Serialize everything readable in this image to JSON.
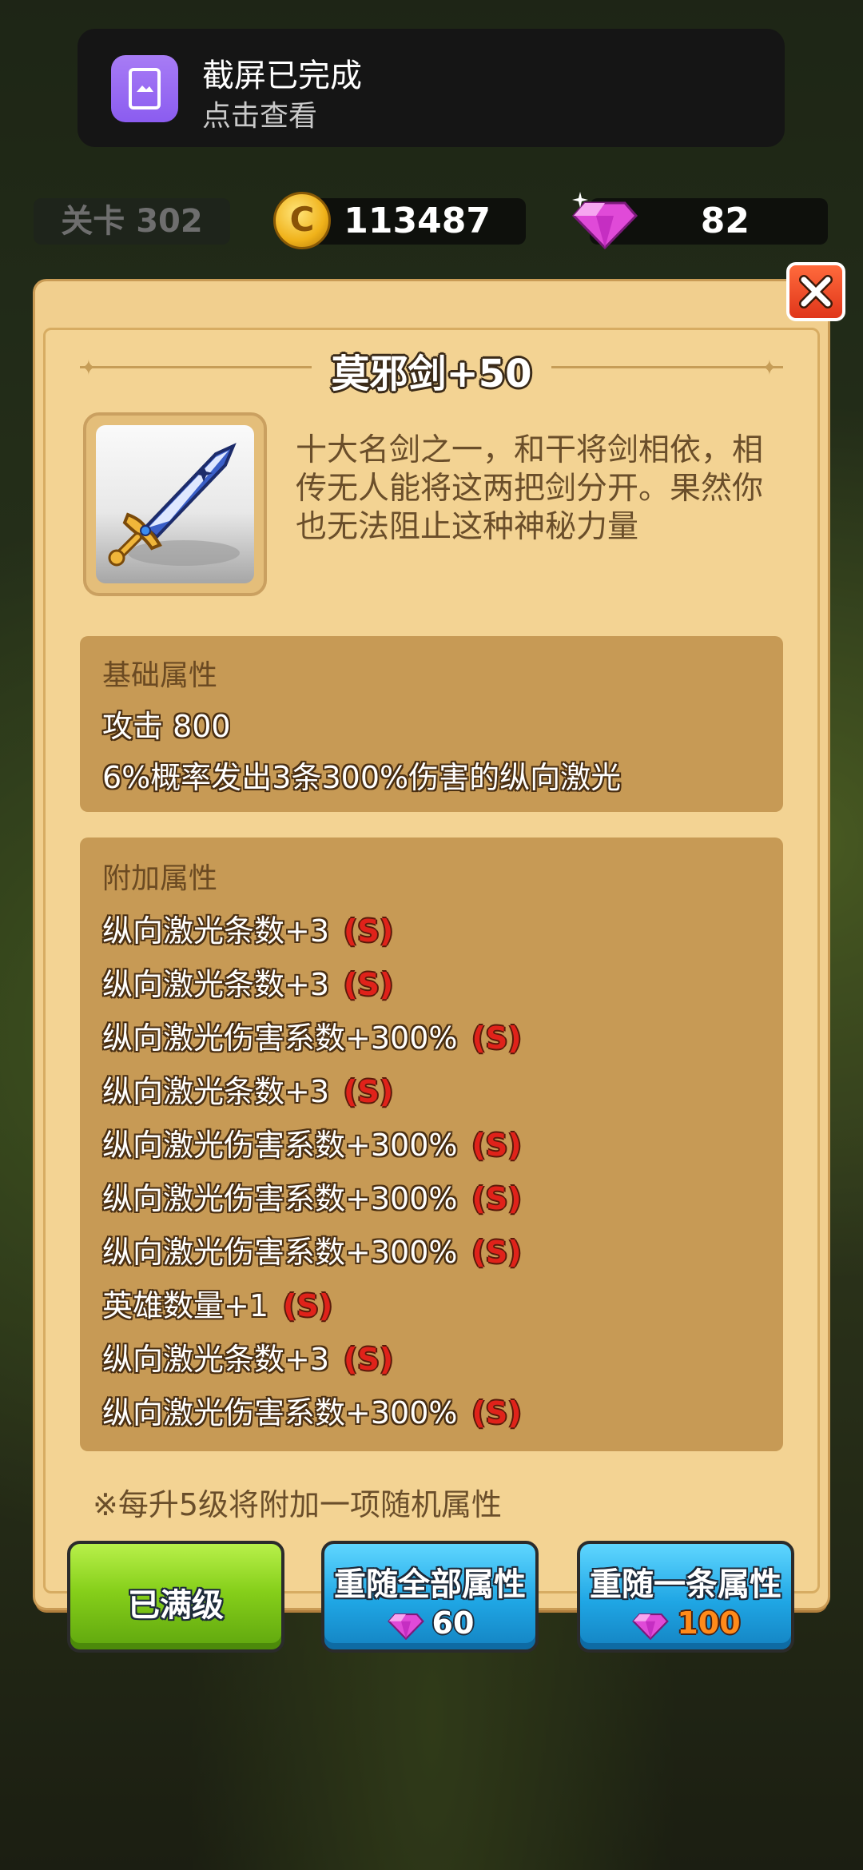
{
  "notification": {
    "title": "截屏已完成",
    "subtitle": "点击查看"
  },
  "topbar": {
    "stage": "关卡 302",
    "coins": "113487",
    "gems": "82",
    "coin_symbol": "C"
  },
  "item": {
    "name": "莫邪剑+50",
    "description": "十大名剑之一，和干将剑相依，相传无人能将这两把剑分开。果然你也无法阻止这种神秘力量"
  },
  "base_attributes": {
    "label": "基础属性",
    "lines": [
      "攻击 800",
      "6%概率发出3条300%伤害的纵向激光"
    ]
  },
  "extra_attributes": {
    "label": "附加属性",
    "lines": [
      {
        "text": "纵向激光条数+3",
        "grade": "(S)"
      },
      {
        "text": "纵向激光条数+3",
        "grade": "(S)"
      },
      {
        "text": "纵向激光伤害系数+300%",
        "grade": "(S)"
      },
      {
        "text": "纵向激光条数+3",
        "grade": "(S)"
      },
      {
        "text": "纵向激光伤害系数+300%",
        "grade": "(S)"
      },
      {
        "text": "纵向激光伤害系数+300%",
        "grade": "(S)"
      },
      {
        "text": "纵向激光伤害系数+300%",
        "grade": "(S)"
      },
      {
        "text": "英雄数量+1",
        "grade": "(S)"
      },
      {
        "text": "纵向激光条数+3",
        "grade": "(S)"
      },
      {
        "text": "纵向激光伤害系数+300%",
        "grade": "(S)"
      }
    ]
  },
  "note": "※每升5级将附加一项随机属性",
  "buttons": {
    "max_level": "已满级",
    "reroll_all": {
      "label": "重随全部属性",
      "cost": "60"
    },
    "reroll_one": {
      "label": "重随一条属性",
      "cost": "100"
    }
  },
  "colors": {
    "panel": "#f3d393",
    "attr_box": "#c79a55",
    "grade": "#e0221a",
    "green_button": "#86cf1a",
    "blue_button": "#1fa6e4"
  }
}
